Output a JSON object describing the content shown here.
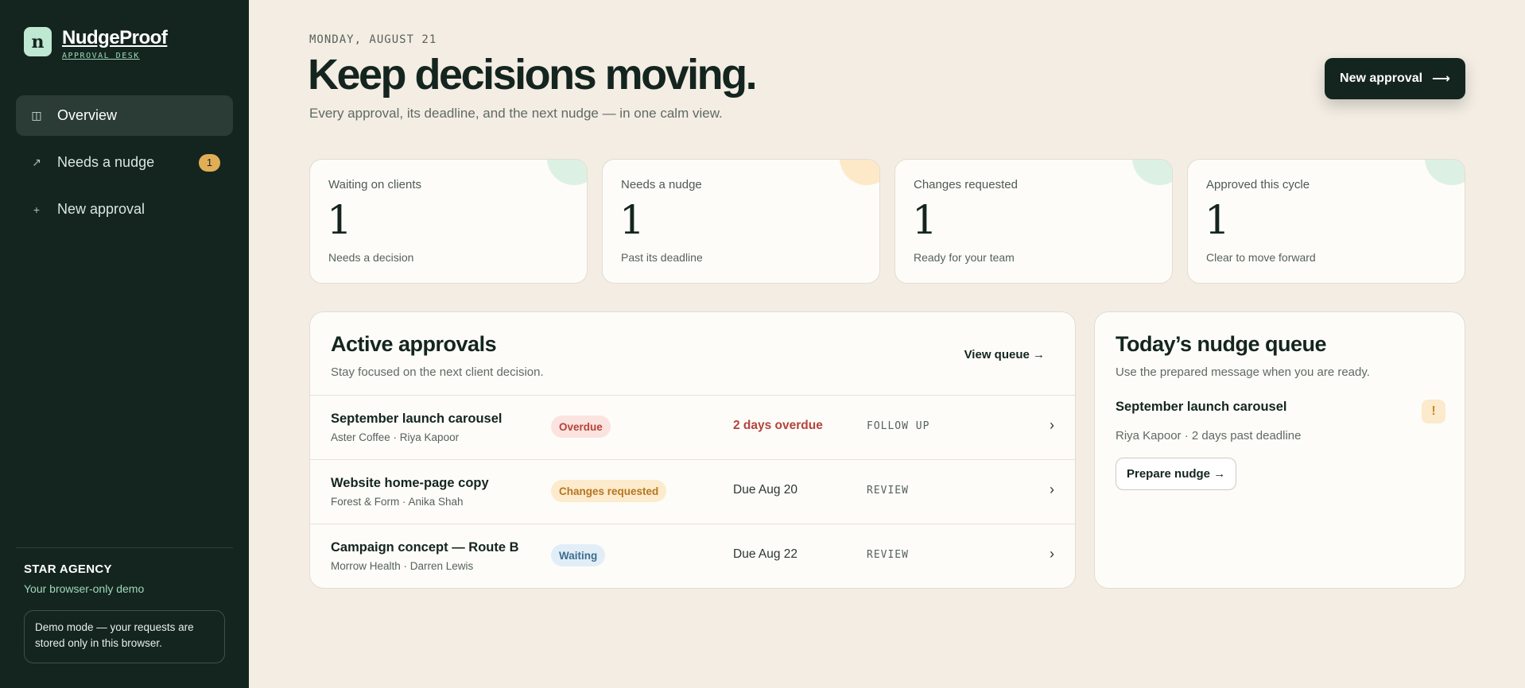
{
  "sidebar": {
    "logo_letter": "n",
    "brand_name": "NudgeProof",
    "brand_sub": "APPROVAL DESK",
    "nav": [
      {
        "label": "Overview",
        "icon": "panel-icon",
        "glyph": "◫",
        "active": true
      },
      {
        "label": "Needs a nudge",
        "icon": "arrow-up-right-icon",
        "glyph": "↗",
        "badge": "1"
      },
      {
        "label": "New approval",
        "icon": "plus-icon",
        "glyph": "+"
      }
    ],
    "agency_name": "STAR AGENCY",
    "agency_sub": "Your browser-only demo",
    "demo_note": "Demo mode — your requests are stored only in this browser."
  },
  "header": {
    "date": "MONDAY, AUGUST 21",
    "title": "Keep decisions moving.",
    "subtitle": "Every approval, its deadline, and the next nudge — in one calm view.",
    "new_button": "New approval",
    "new_button_arrow": "⟶"
  },
  "stats": [
    {
      "label": "Waiting on clients",
      "value": "1",
      "note": "Needs a decision",
      "accent": "#dcf1e4"
    },
    {
      "label": "Needs a nudge",
      "value": "1",
      "note": "Past its deadline",
      "accent": "#fde9c8"
    },
    {
      "label": "Changes requested",
      "value": "1",
      "note": "Ready for your team",
      "accent": "#dcf1e4"
    },
    {
      "label": "Approved this cycle",
      "value": "1",
      "note": "Clear to move forward",
      "accent": "#dcf1e4"
    }
  ],
  "approvals": {
    "title": "Active approvals",
    "subtitle": "Stay focused on the next client decision.",
    "view_queue": "View queue →",
    "rows": [
      {
        "title": "September launch carousel",
        "meta": "Aster Coffee · Riya Kapoor",
        "status": "Overdue",
        "status_bg": "#fbe3df",
        "status_fg": "#b3443a",
        "due": "2 days overdue",
        "overdue": true,
        "action": "FOLLOW UP",
        "chevron": "›"
      },
      {
        "title": "Website home-page copy",
        "meta": "Forest & Form · Anika Shah",
        "status": "Changes requested",
        "status_bg": "#fcebcc",
        "status_fg": "#b8751f",
        "due": "Due Aug 20",
        "overdue": false,
        "action": "REVIEW",
        "chevron": "›"
      },
      {
        "title": "Campaign concept — Route B",
        "meta": "Morrow Health · Darren Lewis",
        "status": "Waiting",
        "status_bg": "#e2eef7",
        "status_fg": "#3d6d8f",
        "due": "Due Aug 22",
        "overdue": false,
        "action": "REVIEW",
        "chevron": "›"
      }
    ]
  },
  "queue": {
    "title": "Today’s nudge queue",
    "subtitle": "Use the prepared message when you are ready.",
    "item_title": "September launch carousel",
    "item_meta": "Riya Kapoor · 2 days past deadline",
    "warn_glyph": "!",
    "button": "Prepare nudge →"
  }
}
